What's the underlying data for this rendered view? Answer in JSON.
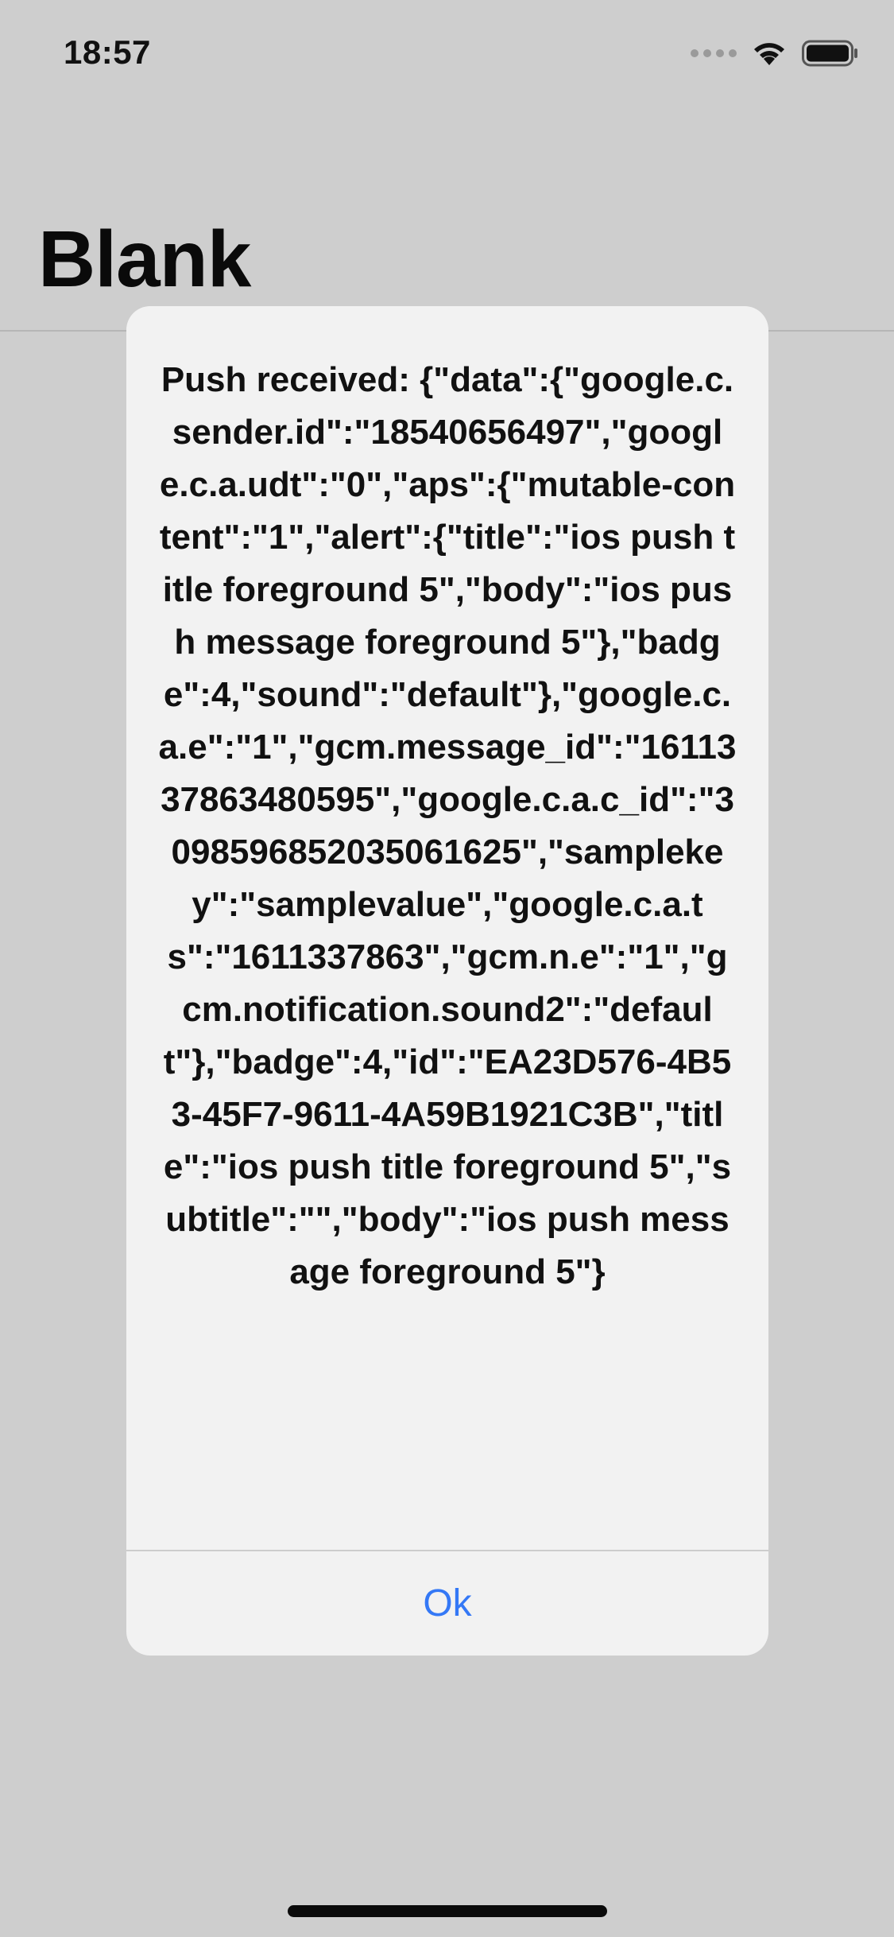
{
  "status_bar": {
    "time": "18:57",
    "signal_icon": "signal-dots-icon",
    "wifi_icon": "wifi-icon",
    "battery_icon": "battery-icon"
  },
  "nav": {
    "title": "Blank"
  },
  "alert": {
    "message": "Push received: {\"data\":{\"google.c.sender.id\":\"18540656497\",\"google.c.a.udt\":\"0\",\"aps\":{\"mutable-content\":\"1\",\"alert\":{\"title\":\"ios push title foreground 5\",\"body\":\"ios push message foreground 5\"},\"badge\":4,\"sound\":\"default\"},\"google.c.a.e\":\"1\",\"gcm.message_id\":\"1611337863480595\",\"google.c.a.c_id\":\"3098596852035061625\",\"samplekey\":\"samplevalue\",\"google.c.a.ts\":\"1611337863\",\"gcm.n.e\":\"1\",\"gcm.notification.sound2\":\"default\"},\"badge\":4,\"id\":\"EA23D576-4B53-45F7-9611-4A59B1921C3B\",\"title\":\"ios push title foreground 5\",\"subtitle\":\"\",\"body\":\"ios push message foreground 5\"}",
    "ok_label": "Ok"
  },
  "colors": {
    "background": "#cecece",
    "alert_background": "#f2f2f2",
    "accent": "#3478f6"
  }
}
